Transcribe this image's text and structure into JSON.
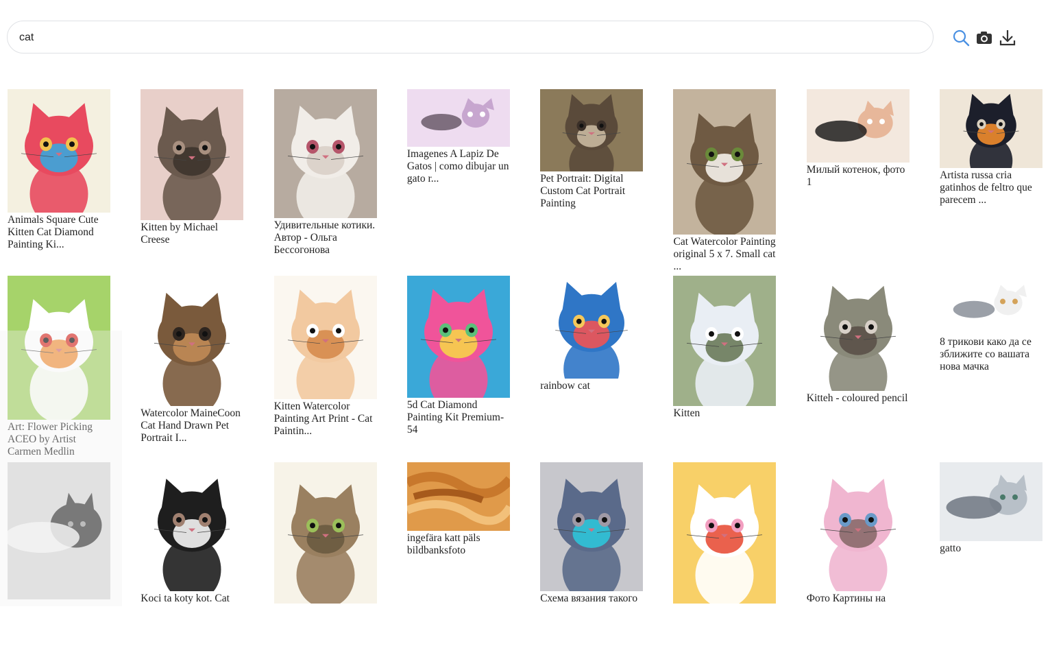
{
  "search": {
    "query": "cat"
  },
  "toolbar": {
    "search_icon": "search-icon",
    "camera_icon": "camera-icon",
    "download_icon": "download-icon",
    "accent": "#4a90e2"
  },
  "results": [
    {
      "caption": "Animals Square Cute Kitten Cat Diamond Painting Ki...",
      "palette": [
        "#f4f0e0",
        "#e84a5f",
        "#3aa6dd",
        "#f2c14e"
      ]
    },
    {
      "caption": "Kitten by Michael Creese",
      "palette": [
        "#e8cfc9",
        "#6b5a4e",
        "#3e342d",
        "#a89080"
      ]
    },
    {
      "caption": "Удивительные котики. Автор - Ольга Бессогонова",
      "palette": [
        "#b7aba0",
        "#f1ede8",
        "#d9cfc8",
        "#b5556a"
      ]
    },
    {
      "caption": "Imagenes A Lapiz De Gatos | como dibujar un gato r...",
      "palette": [
        "#eedcf0",
        "#6a5a6a",
        "#c7a6cf",
        "#ffffff"
      ]
    },
    {
      "caption": "Pet Portrait: Digital Custom Cat Portrait Painting",
      "palette": [
        "#8b7a5a",
        "#5a4a3a",
        "#c8b8a0",
        "#3a2f28"
      ]
    },
    {
      "caption": "Cat Watercolor Painting original 5 x 7. Small cat ...",
      "palette": [
        "#c3b39d",
        "#6f5a43",
        "#f4f0ea",
        "#6a8a3a"
      ]
    },
    {
      "caption": "Милый котенок, фото 1",
      "palette": [
        "#f3e8de",
        "#1f1f1f",
        "#e7b79a",
        "#ffffff"
      ]
    },
    {
      "caption": "Artista russa cria gatinhos de feltro que parecem ...",
      "palette": [
        "#efe6d8",
        "#1c1f2b",
        "#f08b2c",
        "#d9d0bf"
      ]
    },
    {
      "caption": "Art: Flower Picking ACEO by Artist Carmen Medlin",
      "palette": [
        "#a6d36a",
        "#ffffff",
        "#f08a2e",
        "#d9342b"
      ]
    },
    {
      "caption": "Watercolor MaineCoon Cat Hand Drawn Pet Portrait I...",
      "palette": [
        "#ffffff",
        "#7a5a3c",
        "#c08a55",
        "#2f2620"
      ]
    },
    {
      "caption": "Kitten Watercolor Painting Art Print - Cat Paintin...",
      "palette": [
        "#fbf7f0",
        "#f2c9a0",
        "#d68b4c",
        "#ffffff"
      ]
    },
    {
      "caption": "5d Cat Diamond Painting Kit Premium-54",
      "palette": [
        "#3aa8d8",
        "#f0549a",
        "#f6d14a",
        "#5bc07a"
      ]
    },
    {
      "caption": "rainbow cat",
      "palette": [
        "#ffffff",
        "#2f76c6",
        "#f05454",
        "#f5c85a"
      ]
    },
    {
      "caption": "Kitten",
      "palette": [
        "#9fb08a",
        "#e9eef4",
        "#6a7a5a",
        "#ffffff"
      ]
    },
    {
      "caption": "Kitteh - coloured pencil",
      "palette": [
        "#ffffff",
        "#8a8a7a",
        "#5a5048",
        "#d8d0c8"
      ]
    },
    {
      "caption": "8 трикови како да се зближите со вашата нова мачка",
      "palette": [
        "#ffffff",
        "#8a8f99",
        "#f0f0f0",
        "#d4a35a"
      ]
    },
    {
      "caption": "",
      "palette": [
        "#d9d9d9",
        "#f5f5f5",
        "#3a3a3a",
        "#a0a0a0"
      ]
    },
    {
      "caption": "Koci ta koty kot. Cat",
      "palette": [
        "#ffffff",
        "#1e1e1e",
        "#f4f4f4",
        "#a08070"
      ]
    },
    {
      "caption": "",
      "palette": [
        "#f7f3e8",
        "#9a8060",
        "#6a5a40",
        "#9bbf5a"
      ]
    },
    {
      "caption": "ingefära katt päls bildbanksfoto",
      "palette": [
        "#e09a4a",
        "#c8782c",
        "#f2c07a",
        "#a65a1c"
      ]
    },
    {
      "caption": "Схема вязания такого",
      "palette": [
        "#c7c7cc",
        "#5a6a8a",
        "#2ec4d8",
        "#a09aa6"
      ]
    },
    {
      "caption": "",
      "palette": [
        "#f8d068",
        "#ffffff",
        "#e8503a",
        "#f29ec0"
      ]
    },
    {
      "caption": "Фото Картины на",
      "palette": [
        "#ffffff",
        "#f0b6d0",
        "#8a6a6a",
        "#6a9ac8"
      ]
    },
    {
      "caption": "gatto",
      "palette": [
        "#e8ebee",
        "#6e7781",
        "#b8c0c8",
        "#4a7a6a"
      ]
    }
  ]
}
